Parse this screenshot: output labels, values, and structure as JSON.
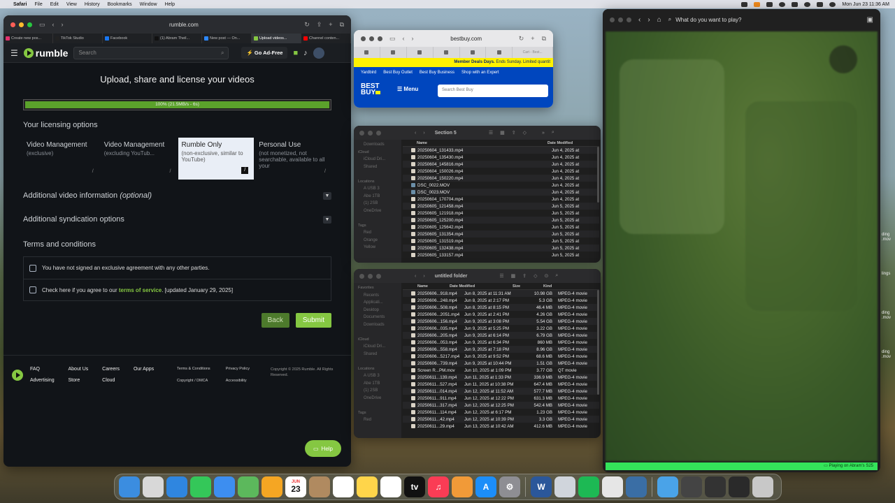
{
  "menubar": {
    "app_name": "Safari",
    "items": [
      "File",
      "Edit",
      "View",
      "History",
      "Bookmarks",
      "Window",
      "Help"
    ],
    "clock": "Mon Jun 23  11:36 AM"
  },
  "rumble": {
    "url": "rumble.com",
    "tabs": [
      {
        "label": "Create new pos...",
        "color": "#e1306c"
      },
      {
        "label": "TikTok Studio",
        "color": "#222222"
      },
      {
        "label": "Facebook",
        "color": "#1877f2"
      },
      {
        "label": "(1) Abram Theil...",
        "color": "#111111"
      },
      {
        "label": "New post — On...",
        "color": "#2d88ff"
      },
      {
        "label": "Upload videos...",
        "color": "#85c742"
      },
      {
        "label": "Channel conten...",
        "color": "#ff0000"
      }
    ],
    "logo_text": "rumble",
    "search_placeholder": "Search",
    "go_ad_free": "Go Ad-Free",
    "page_title": "Upload, share and license your videos",
    "progress": {
      "fraction": 1.0,
      "text": "100%  (21.5MB/s - 6s)"
    },
    "licensing_title": "Your licensing options",
    "license_options": [
      {
        "title": "Video Management",
        "sub": "(exclusive)",
        "selected": false
      },
      {
        "title": "Video Management",
        "sub": "(excluding YouTub...",
        "selected": false
      },
      {
        "title": "Rumble Only",
        "sub": "(non-exclusive, similar to YouTube)",
        "selected": true
      },
      {
        "title": "Personal Use",
        "sub": "(not monetized, not searchable, available to all your",
        "selected": false
      }
    ],
    "additional_info_title": "Additional video information",
    "additional_info_optional": "(optional)",
    "syndication_title": "Additional syndication options",
    "terms_title": "Terms and conditions",
    "terms_agreement": "You have not signed an exclusive agreement with any other parties.",
    "terms_check_prefix": "Check here if you agree to our",
    "terms_link": "terms of service",
    "terms_check_suffix": ". [updated January 29, 2025]",
    "back_label": "Back",
    "submit_label": "Submit",
    "footer_links": [
      "FAQ",
      "About Us",
      "Careers",
      "Our Apps",
      "Advertising",
      "Store",
      "Cloud"
    ],
    "footer_links2": [
      "Terms & Conditions",
      "Privacy Policy",
      "Copyright / DMCA",
      "Accessibility"
    ],
    "copyright": "Copyright © 2025 Rumble. All Rights Reserved.",
    "help_label": "Help"
  },
  "bestbuy": {
    "url": "bestbuy.com",
    "last_tab": "Cart - Best...",
    "banner_strong": "Member Deals Days.",
    "banner_rest": " Ends Sunday. Limited quantit",
    "nav_links": [
      "Yardbird",
      "Best Buy Outlet",
      "Best Buy Business",
      "Shop with an Expert"
    ],
    "logo_line1": "BEST",
    "logo_line2": "BUY",
    "menu_label": "Menu",
    "search_placeholder": "Search Best Buy"
  },
  "finder1": {
    "title": "Section 5",
    "sidebar": [
      "Downloads",
      "iCloud",
      "iCloud Dri...",
      "Shared",
      "",
      "Locations",
      "A USB 3",
      "Abe 1TB",
      "(1) 2SB",
      "OneDrive",
      "",
      "Tags",
      "Red",
      "Orange",
      "Yellow"
    ],
    "col_name": "Name",
    "col_date": "Date Modified",
    "rows": [
      {
        "name": "20250604_131433.mp4",
        "date": "Jun 4, 2025 at"
      },
      {
        "name": "20250604_135430.mp4",
        "date": "Jun 4, 2025 at"
      },
      {
        "name": "20250604_145816.mp4",
        "date": "Jun 4, 2025 at"
      },
      {
        "name": "20250604_150026.mp4",
        "date": "Jun 4, 2025 at"
      },
      {
        "name": "20250604_150220.mp4",
        "date": "Jun 4, 2025 at"
      },
      {
        "name": "DSC_0022.MOV",
        "date": "Jun 4, 2025 at"
      },
      {
        "name": "DSC_0023.MOV",
        "date": "Jun 4, 2025 at"
      },
      {
        "name": "20250604_170704.mp4",
        "date": "Jun 4, 2025 at"
      },
      {
        "name": "20250605_121458.mp4",
        "date": "Jun 5, 2025 at"
      },
      {
        "name": "20250605_121918.mp4",
        "date": "Jun 5, 2025 at"
      },
      {
        "name": "20250605_125200.mp4",
        "date": "Jun 5, 2025 at"
      },
      {
        "name": "20250605_125642.mp4",
        "date": "Jun 5, 2025 at"
      },
      {
        "name": "20250605_131354.mp4",
        "date": "Jun 5, 2025 at"
      },
      {
        "name": "20250605_131519.mp4",
        "date": "Jun 5, 2025 at"
      },
      {
        "name": "20250605_132438.mp4",
        "date": "Jun 5, 2025 at"
      },
      {
        "name": "20250605_133157.mp4",
        "date": "Jun 5, 2025 at"
      }
    ]
  },
  "finder2": {
    "title": "untitled folder",
    "sidebar": [
      "Favorites",
      "Recents",
      "Applicati...",
      "Desktop",
      "Documents",
      "Downloads",
      "",
      "iCloud",
      "iCloud Dri...",
      "Shared",
      "",
      "Locations",
      "A USB 3",
      "Abe 1TB",
      "(1) 2SB",
      "OneDrive",
      "",
      "Tags",
      "Red"
    ],
    "col_name": "Name",
    "col_date": "Date Modified",
    "col_size": "Size",
    "col_kind": "Kind",
    "rows": [
      {
        "name": "20250606...918.mp4",
        "date": "Jun 8, 2025 at 11:31 AM",
        "size": "10.98 GB",
        "kind": "MPEG-4 movie"
      },
      {
        "name": "20250606...248.mp4",
        "date": "Jun 8, 2025 at 2:17 PM",
        "size": "5.3 GB",
        "kind": "MPEG-4 movie"
      },
      {
        "name": "20250606...508.mp4",
        "date": "Jun 8, 2025 at 8:15 PM",
        "size": "46.4 MB",
        "kind": "MPEG-4 movie"
      },
      {
        "name": "20250606...2051.mp4",
        "date": "Jun 9, 2025 at 2:41 PM",
        "size": "4.26 GB",
        "kind": "MPEG-4 movie"
      },
      {
        "name": "20250606...156.mp4",
        "date": "Jun 9, 2025 at 3:08 PM",
        "size": "5.54 GB",
        "kind": "MPEG-4 movie"
      },
      {
        "name": "20250606...035.mp4",
        "date": "Jun 9, 2025 at 5:25 PM",
        "size": "3.22 GB",
        "kind": "MPEG-4 movie"
      },
      {
        "name": "20250606...205.mp4",
        "date": "Jun 9, 2025 at 6:14 PM",
        "size": "6.79 GB",
        "kind": "MPEG-4 movie"
      },
      {
        "name": "20250606...053.mp4",
        "date": "Jun 9, 2025 at 6:34 PM",
        "size": "860 MB",
        "kind": "MPEG-4 movie"
      },
      {
        "name": "20250606...558.mp4",
        "date": "Jun 9, 2025 at 7:18 PM",
        "size": "8.96 GB",
        "kind": "MPEG-4 movie"
      },
      {
        "name": "20250606...5217.mp4",
        "date": "Jun 9, 2025 at 9:52 PM",
        "size": "68.6 MB",
        "kind": "MPEG-4 movie"
      },
      {
        "name": "20250606...739.mp4",
        "date": "Jun 9, 2025 at 10:44 PM",
        "size": "1.51 GB",
        "kind": "MPEG-4 movie"
      },
      {
        "name": "Screen R...PM.mov",
        "date": "Jun 10, 2025 at 1:09 PM",
        "size": "3.77 GB",
        "kind": "QT movie"
      },
      {
        "name": "20250611...139.mp4",
        "date": "Jun 11, 2025 at 1:33 PM",
        "size": "336.9 MB",
        "kind": "MPEG-4 movie"
      },
      {
        "name": "20250611...527.mp4",
        "date": "Jun 11, 2025 at 10:38 PM",
        "size": "647.4 MB",
        "kind": "MPEG-4 movie"
      },
      {
        "name": "20250611...014.mp4",
        "date": "Jun 12, 2025 at 11:52 AM",
        "size": "577.7 MB",
        "kind": "MPEG-4 movie"
      },
      {
        "name": "20250611...911.mp4",
        "date": "Jun 12, 2025 at 12:22 PM",
        "size": "631.3 MB",
        "kind": "MPEG-4 movie"
      },
      {
        "name": "20250611...317.mp4",
        "date": "Jun 12, 2025 at 12:25 PM",
        "size": "542.4 MB",
        "kind": "MPEG-4 movie"
      },
      {
        "name": "20250611...114.mp4",
        "date": "Jun 12, 2025 at 6:17 PM",
        "size": "1.23 GB",
        "kind": "MPEG-4 movie"
      },
      {
        "name": "20250611...42.mp4",
        "date": "Jun 12, 2025 at 10:39 PM",
        "size": "3.3 GB",
        "kind": "MPEG-4 movie"
      },
      {
        "name": "20250611...29.mp4",
        "date": "Jun 13, 2025 at 10:42 AM",
        "size": "412.6 MB",
        "kind": "MPEG-4 movie"
      }
    ]
  },
  "game": {
    "search_placeholder": "What do you want to play?",
    "status": "Playing on Abram's S25"
  },
  "side_labels": [
    "ding",
    ".mov",
    "lings",
    "ding",
    ".mov",
    "ding",
    ".mov"
  ],
  "dock": {
    "calendar_month": "JUN",
    "calendar_day": "23",
    "icons": [
      {
        "name": "finder-icon",
        "color": "#3b8de0",
        "glyph": ""
      },
      {
        "name": "launchpad-icon",
        "color": "#d8d8d8",
        "glyph": ""
      },
      {
        "name": "safari-icon",
        "color": "#2f86e0",
        "glyph": ""
      },
      {
        "name": "messages-icon",
        "color": "#34c759",
        "glyph": ""
      },
      {
        "name": "mail-icon",
        "color": "#3d8ef0",
        "glyph": ""
      },
      {
        "name": "maps-icon",
        "color": "#5cb85c",
        "glyph": ""
      },
      {
        "name": "photos-icon",
        "color": "#f5a623",
        "glyph": ""
      },
      {
        "name": "calendar-icon",
        "color": "#ffffff",
        "glyph": ""
      },
      {
        "name": "contacts-icon",
        "color": "#b08a60",
        "glyph": ""
      },
      {
        "name": "reminders-icon",
        "color": "#ffffff",
        "glyph": ""
      },
      {
        "name": "notes-icon",
        "color": "#ffd54a",
        "glyph": ""
      },
      {
        "name": "freeform-icon",
        "color": "#ffffff",
        "glyph": ""
      },
      {
        "name": "tv-icon",
        "color": "#111111",
        "glyph": "tv"
      },
      {
        "name": "music-icon",
        "color": "#fa3c55",
        "glyph": "♫"
      },
      {
        "name": "pages-icon",
        "color": "#f19a38",
        "glyph": ""
      },
      {
        "name": "app-store-icon",
        "color": "#1c8ef9",
        "glyph": "A"
      },
      {
        "name": "settings-icon",
        "color": "#8e8e93",
        "glyph": "⚙"
      },
      {
        "name": "word-icon",
        "color": "#2b579a",
        "glyph": "W"
      },
      {
        "name": "preview-icon",
        "color": "#d0d5dc",
        "glyph": ""
      },
      {
        "name": "spotify-icon",
        "color": "#1db954",
        "glyph": ""
      },
      {
        "name": "chart-app-icon",
        "color": "#e6e6e6",
        "glyph": ""
      },
      {
        "name": "quicktime-icon",
        "color": "#3a6ea5",
        "glyph": ""
      },
      {
        "name": "folder-icon",
        "color": "#4aa3e8",
        "glyph": ""
      },
      {
        "name": "minimized-window-icon",
        "color": "#444444",
        "glyph": ""
      },
      {
        "name": "minimized-window-icon-2",
        "color": "#333333",
        "glyph": ""
      },
      {
        "name": "minimized-window-icon-3",
        "color": "#2a2a2a",
        "glyph": ""
      },
      {
        "name": "trash-icon",
        "color": "#c8c8c8",
        "glyph": ""
      }
    ]
  }
}
